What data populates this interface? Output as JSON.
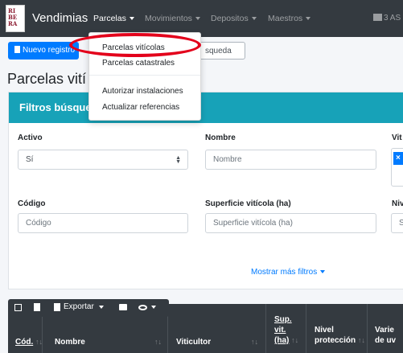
{
  "navbar": {
    "logo_lines": [
      "RI",
      "BE",
      "RA"
    ],
    "brand": "Vendimias",
    "menus": [
      {
        "label": "Parcelas",
        "active": true
      },
      {
        "label": "Movimientos",
        "active": false
      },
      {
        "label": "Depositos",
        "active": false
      },
      {
        "label": "Maestros",
        "active": false
      }
    ],
    "right_text": "3 AS"
  },
  "dropdown": {
    "items_top": [
      "Parcelas vitícolas",
      "Parcelas catastrales"
    ],
    "items_bottom": [
      "Autorizar instalaciones",
      "Actualizar referencias"
    ]
  },
  "toolbar": {
    "new_record": "Nuevo registro",
    "search_button": "squeda"
  },
  "page": {
    "title": "Parcelas vití"
  },
  "filters": {
    "header": "Filtros búsque",
    "activo_label": "Activo",
    "activo_value": "Sí",
    "nombre_label": "Nombre",
    "nombre_placeholder": "Nombre",
    "viticultor_label": "Vit",
    "codigo_label": "Código",
    "codigo_placeholder": "Código",
    "superficie_label": "Superficie vitícola (ha)",
    "superficie_placeholder": "Superficie vitícola (ha)",
    "nivel_label": "Niv",
    "nivel_placeholder": "S",
    "tag_remove": "×",
    "more_filters": "Mostrar más filtros"
  },
  "table_toolbar": {
    "export": "Exportar"
  },
  "table": {
    "columns": [
      "Cód.",
      "Nombre",
      "Viticultor",
      "Sup.",
      "vit.",
      "(ha)",
      "Nivel",
      "protección",
      "Varie",
      "de uv"
    ]
  }
}
